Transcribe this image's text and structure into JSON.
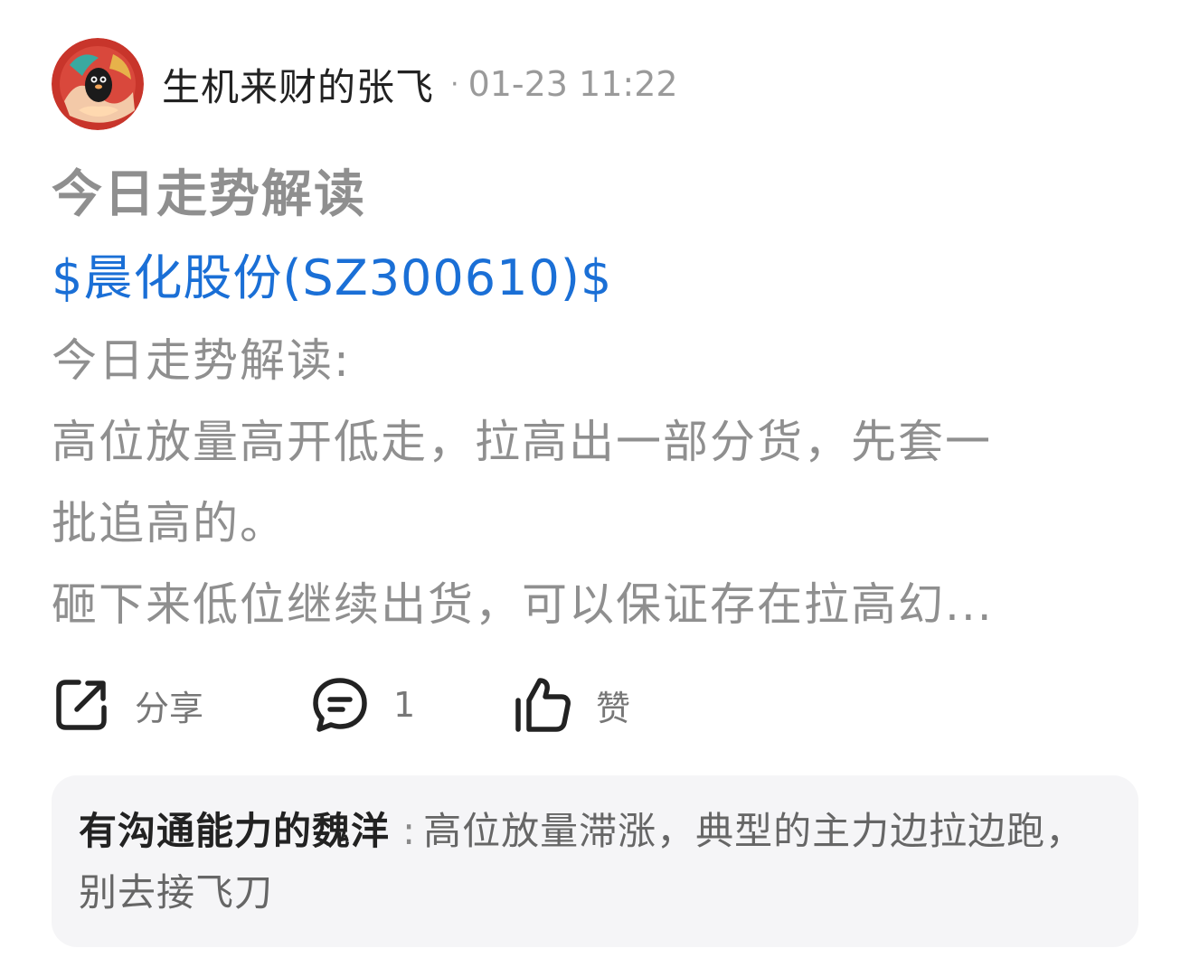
{
  "header": {
    "author_name": "生机来财的张飞",
    "separator": "·",
    "post_time": "01-23 11:22"
  },
  "post": {
    "title": "今日走势解读",
    "stock_link": "$晨化股份(SZ300610)$",
    "body_lines": [
      "今日走势解读:",
      "高位放量高开低走，拉高出一部分货，先套一",
      "批追高的。",
      "砸下来低位继续出货，可以保证存在拉高幻..."
    ]
  },
  "actions": {
    "share_label": "分享",
    "comment_count": "1",
    "like_label": "赞"
  },
  "comment": {
    "author": "有沟通能力的魏洋",
    "separator": ":",
    "text": "高位放量滞涨，典型的主力边拉边跑，别去接飞刀"
  },
  "colors": {
    "link": "#1a6fd6",
    "muted_text": "#8f8f8f",
    "comment_bg": "#f5f5f7"
  },
  "icons": {
    "share": "share-icon",
    "comment": "comment-icon",
    "like": "thumbs-up-icon"
  }
}
